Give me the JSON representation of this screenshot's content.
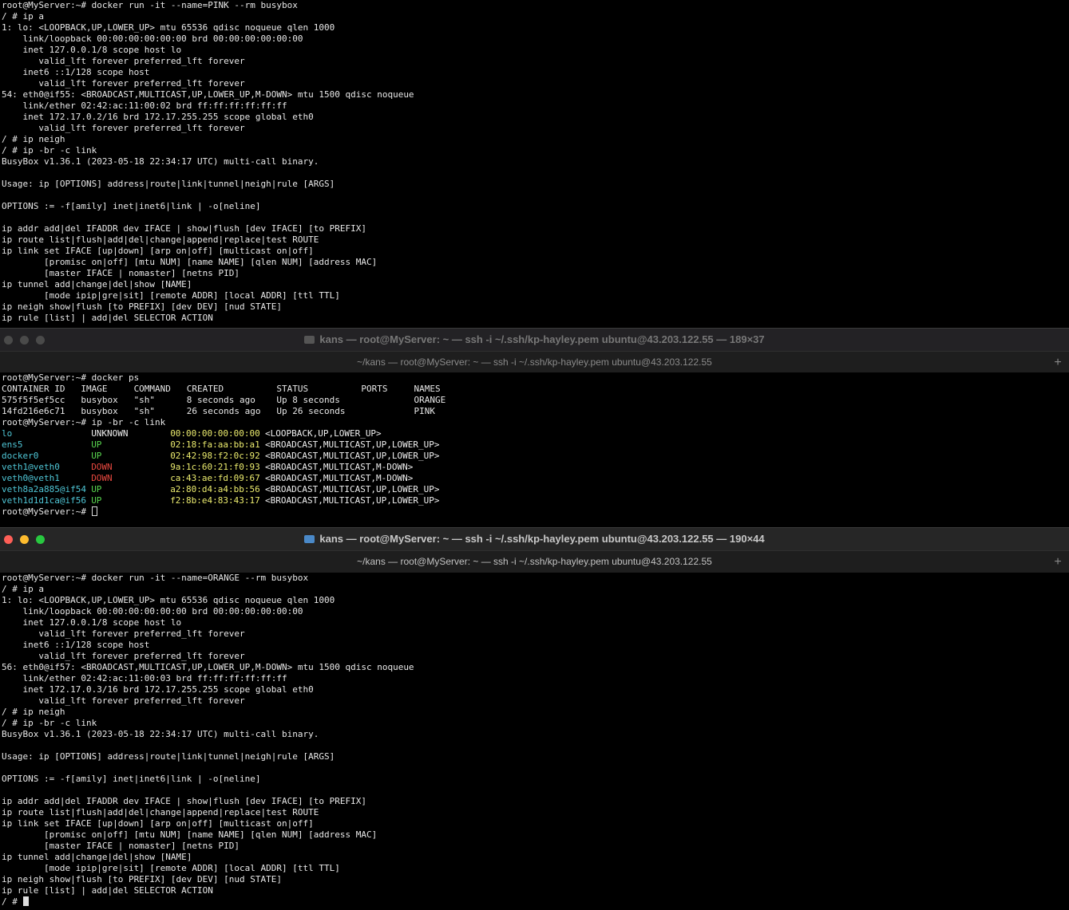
{
  "pane1": {
    "lines": [
      "root@MyServer:~# docker run -it --name=PINK --rm busybox",
      "/ # ip a",
      "1: lo: <LOOPBACK,UP,LOWER_UP> mtu 65536 qdisc noqueue qlen 1000",
      "    link/loopback 00:00:00:00:00:00 brd 00:00:00:00:00:00",
      "    inet 127.0.0.1/8 scope host lo",
      "       valid_lft forever preferred_lft forever",
      "    inet6 ::1/128 scope host",
      "       valid_lft forever preferred_lft forever",
      "54: eth0@if55: <BROADCAST,MULTICAST,UP,LOWER_UP,M-DOWN> mtu 1500 qdisc noqueue",
      "    link/ether 02:42:ac:11:00:02 brd ff:ff:ff:ff:ff:ff",
      "    inet 172.17.0.2/16 brd 172.17.255.255 scope global eth0",
      "       valid_lft forever preferred_lft forever",
      "/ # ip neigh",
      "/ # ip -br -c link",
      "BusyBox v1.36.1 (2023-05-18 22:34:17 UTC) multi-call binary.",
      "",
      "Usage: ip [OPTIONS] address|route|link|tunnel|neigh|rule [ARGS]",
      "",
      "OPTIONS := -f[amily] inet|inet6|link | -o[neline]",
      "",
      "ip addr add|del IFADDR dev IFACE | show|flush [dev IFACE] [to PREFIX]",
      "ip route list|flush|add|del|change|append|replace|test ROUTE",
      "ip link set IFACE [up|down] [arp on|off] [multicast on|off]",
      "        [promisc on|off] [mtu NUM] [name NAME] [qlen NUM] [address MAC]",
      "        [master IFACE | nomaster] [netns PID]",
      "ip tunnel add|change|del|show [NAME]",
      "        [mode ipip|gre|sit] [remote ADDR] [local ADDR] [ttl TTL]",
      "ip neigh show|flush [to PREFIX] [dev DEV] [nud STATE]",
      "ip rule [list] | add|del SELECTOR ACTION"
    ]
  },
  "window2": {
    "title": "kans — root@MyServer: ~ — ssh -i ~/.ssh/kp-hayley.pem ubuntu@43.203.122.55 — 189×37",
    "tab": "~/kans — root@MyServer: ~ — ssh -i ~/.ssh/kp-hayley.pem ubuntu@43.203.122.55",
    "newtab": "+"
  },
  "pane2": {
    "ps_prompt": "root@MyServer:~# docker ps",
    "ps_header": "CONTAINER ID   IMAGE     COMMAND   CREATED          STATUS          PORTS     NAMES",
    "ps_rows": [
      "575f5f5ef5cc   busybox   \"sh\"      8 seconds ago    Up 8 seconds              ORANGE",
      "14fd216e6c71   busybox   \"sh\"      26 seconds ago   Up 26 seconds             PINK"
    ],
    "link_prompt": "root@MyServer:~# ip -br -c link",
    "links": [
      {
        "name": "lo",
        "state": "UNKNOWN",
        "mac": "00:00:00:00:00:00",
        "flags": "<LOOPBACK,UP,LOWER_UP>"
      },
      {
        "name": "ens5",
        "state": "UP",
        "mac": "02:18:fa:aa:bb:a1",
        "flags": "<BROADCAST,MULTICAST,UP,LOWER_UP>"
      },
      {
        "name": "docker0",
        "state": "UP",
        "mac": "02:42:98:f2:0c:92",
        "flags": "<BROADCAST,MULTICAST,UP,LOWER_UP>"
      },
      {
        "name": "veth1@veth0",
        "state": "DOWN",
        "mac": "9a:1c:60:21:f0:93",
        "flags": "<BROADCAST,MULTICAST,M-DOWN>"
      },
      {
        "name": "veth0@veth1",
        "state": "DOWN",
        "mac": "ca:43:ae:fd:09:67",
        "flags": "<BROADCAST,MULTICAST,M-DOWN>"
      },
      {
        "name": "veth8a2a885@if54",
        "state": "UP",
        "mac": "a2:80:d4:a4:bb:56",
        "flags": "<BROADCAST,MULTICAST,UP,LOWER_UP>"
      },
      {
        "name": "veth1d1d1ca@if56",
        "state": "UP",
        "mac": "f2:8b:e4:83:43:17",
        "flags": "<BROADCAST,MULTICAST,UP,LOWER_UP>"
      }
    ],
    "final_prompt": "root@MyServer:~# "
  },
  "window3": {
    "title": "kans — root@MyServer: ~ — ssh -i ~/.ssh/kp-hayley.pem ubuntu@43.203.122.55 — 190×44",
    "tab": "~/kans — root@MyServer: ~ — ssh -i ~/.ssh/kp-hayley.pem ubuntu@43.203.122.55",
    "newtab": "+"
  },
  "pane3": {
    "lines": [
      "root@MyServer:~# docker run -it --name=ORANGE --rm busybox",
      "/ # ip a",
      "1: lo: <LOOPBACK,UP,LOWER_UP> mtu 65536 qdisc noqueue qlen 1000",
      "    link/loopback 00:00:00:00:00:00 brd 00:00:00:00:00:00",
      "    inet 127.0.0.1/8 scope host lo",
      "       valid_lft forever preferred_lft forever",
      "    inet6 ::1/128 scope host",
      "       valid_lft forever preferred_lft forever",
      "56: eth0@if57: <BROADCAST,MULTICAST,UP,LOWER_UP,M-DOWN> mtu 1500 qdisc noqueue",
      "    link/ether 02:42:ac:11:00:03 brd ff:ff:ff:ff:ff:ff",
      "    inet 172.17.0.3/16 brd 172.17.255.255 scope global eth0",
      "       valid_lft forever preferred_lft forever",
      "/ # ip neigh",
      "/ # ip -br -c link",
      "BusyBox v1.36.1 (2023-05-18 22:34:17 UTC) multi-call binary.",
      "",
      "Usage: ip [OPTIONS] address|route|link|tunnel|neigh|rule [ARGS]",
      "",
      "OPTIONS := -f[amily] inet|inet6|link | -o[neline]",
      "",
      "ip addr add|del IFADDR dev IFACE | show|flush [dev IFACE] [to PREFIX]",
      "ip route list|flush|add|del|change|append|replace|test ROUTE",
      "ip link set IFACE [up|down] [arp on|off] [multicast on|off]",
      "        [promisc on|off] [mtu NUM] [name NAME] [qlen NUM] [address MAC]",
      "        [master IFACE | nomaster] [netns PID]",
      "ip tunnel add|change|del|show [NAME]",
      "        [mode ipip|gre|sit] [remote ADDR] [local ADDR] [ttl TTL]",
      "ip neigh show|flush [to PREFIX] [dev DEV] [nud STATE]",
      "ip rule [list] | add|del SELECTOR ACTION"
    ],
    "final_prompt": "/ # "
  },
  "colors": {
    "name": "#4fc6d6",
    "up": "#59d64f",
    "down": "#e8483f",
    "unknown": "#f0f0f0",
    "mac": "#ecec6e"
  }
}
